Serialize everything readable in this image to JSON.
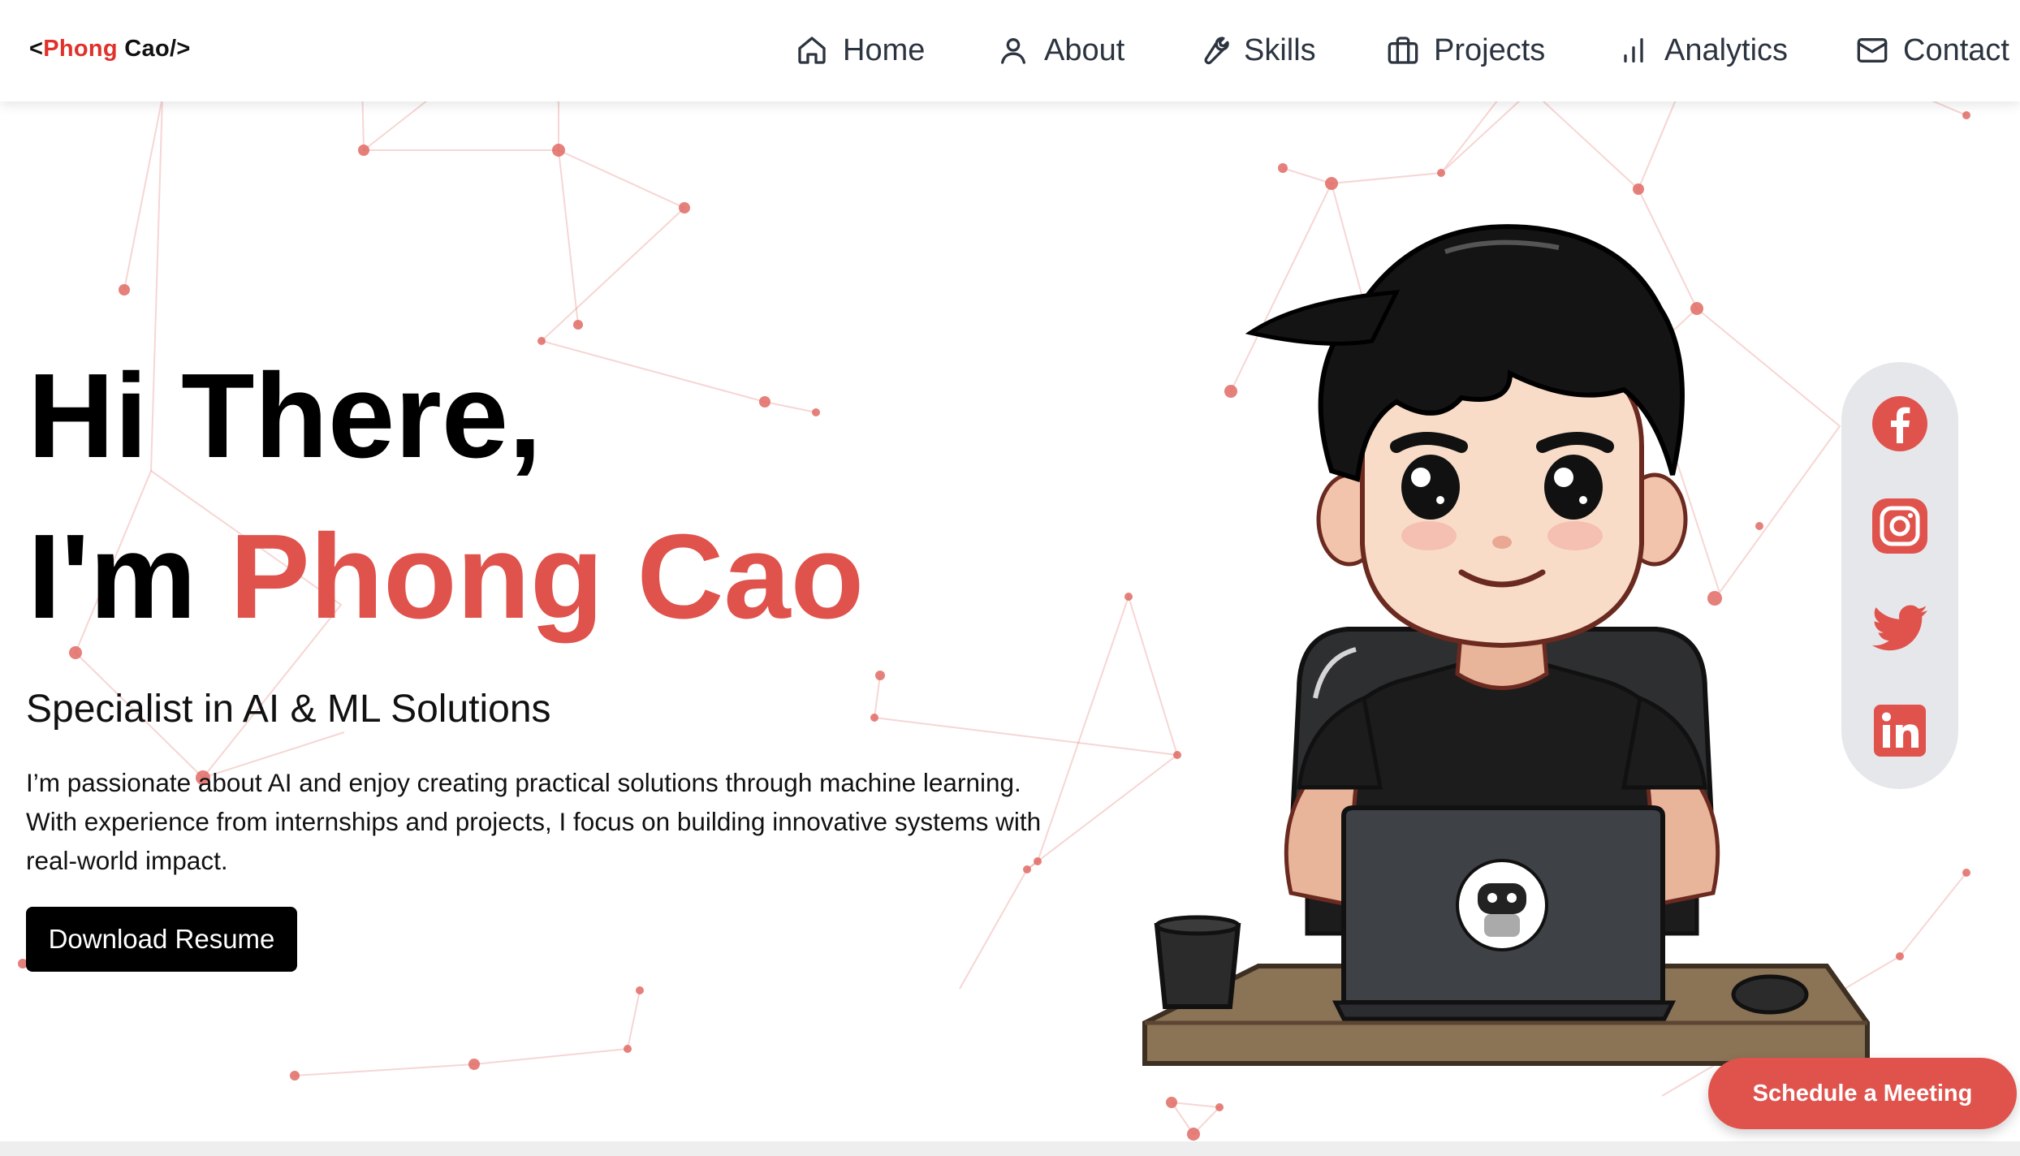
{
  "nav": {
    "logo": {
      "open": "<",
      "first": "Phong",
      "last": " Cao/>"
    },
    "items": [
      {
        "label": "Home",
        "icon": "home-icon"
      },
      {
        "label": "About",
        "icon": "user-icon"
      },
      {
        "label": "Skills",
        "icon": "wrench-icon"
      },
      {
        "label": "Projects",
        "icon": "briefcase-icon"
      },
      {
        "label": "Analytics",
        "icon": "bar-chart-icon"
      },
      {
        "label": "Contact",
        "icon": "mail-icon"
      }
    ]
  },
  "hero": {
    "greeting": "Hi There,",
    "intro": "I'm ",
    "name": "Phong Cao",
    "subtitle": "Specialist in AI & ML Solutions",
    "description": "I’m passionate about AI and enjoy creating practical solutions through machine learning. With experience from internships and projects, I focus on building innovative systems with real-world impact.",
    "resume_button": "Download Resume"
  },
  "social": [
    "facebook-icon",
    "instagram-icon",
    "twitter-icon",
    "linkedin-icon"
  ],
  "schedule_button": "Schedule a Meeting",
  "colors": {
    "accent": "#e0534d",
    "logo_accent": "#e0312a",
    "text": "#000000",
    "nav_text": "#2c3440",
    "button_dark": "#000000",
    "social_bar": "#e6e7eb",
    "network": "#e06a64"
  }
}
